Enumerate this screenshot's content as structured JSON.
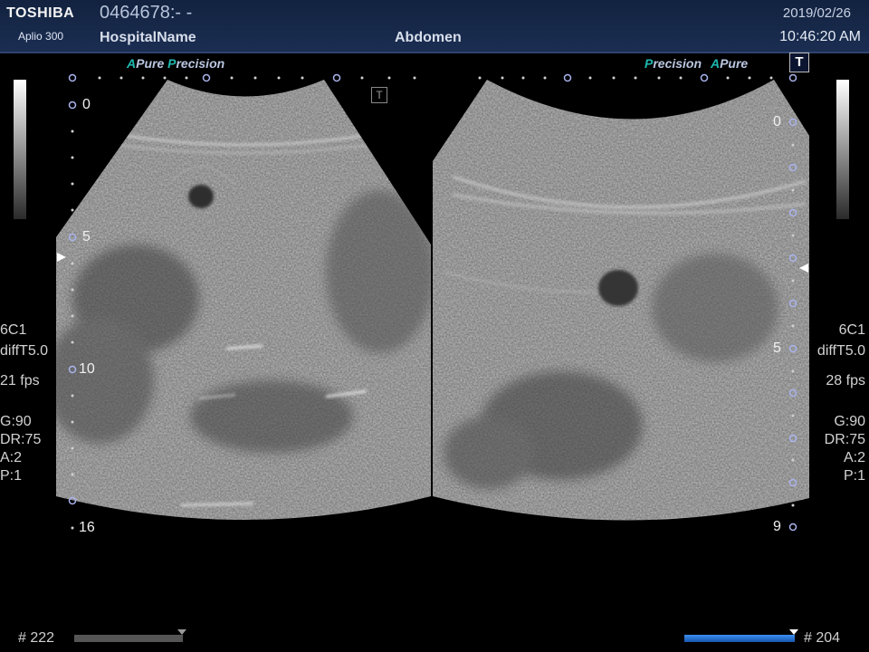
{
  "header": {
    "brand": "TOSHIBA",
    "model": "Aplio 300",
    "patient_id": "0464678:- -",
    "hospital": "HospitalName",
    "exam": "Abdomen",
    "date": "2019/02/26",
    "time": "10:46:20 AM"
  },
  "left_pane": {
    "mode_a": "A",
    "mode_pure": "Pure",
    "mode_p": "P",
    "mode_precision": "recision",
    "t_marker": "T",
    "depth_labels": [
      "0",
      "5",
      "10",
      "16"
    ],
    "probe": "6C1",
    "diff": "diffT5.0",
    "fps": "21 fps",
    "gain": "G:90",
    "dr": "DR:75",
    "a": "A:2",
    "p": "P:1",
    "frame_count": "# 222",
    "cine_position": 1.0
  },
  "right_pane": {
    "mode_p": "P",
    "mode_precision": "recision",
    "mode_a": "A",
    "mode_pure": "Pure",
    "t_marker": "T",
    "depth_labels": [
      "0",
      "5",
      "9"
    ],
    "probe": "6C1",
    "diff": "diffT5.0",
    "fps": "28 fps",
    "gain": "G:90",
    "dr": "DR:75",
    "a": "A:2",
    "p": "P:1",
    "frame_count": "# 204",
    "cine_position": 1.0
  },
  "colors": {
    "header_bg": "#1b2e52",
    "accent_teal": "#1fb8b0",
    "cine_bar_left": "#555555",
    "cine_bar_right": "#1e6fd6",
    "marker": "#9aa8e8"
  }
}
